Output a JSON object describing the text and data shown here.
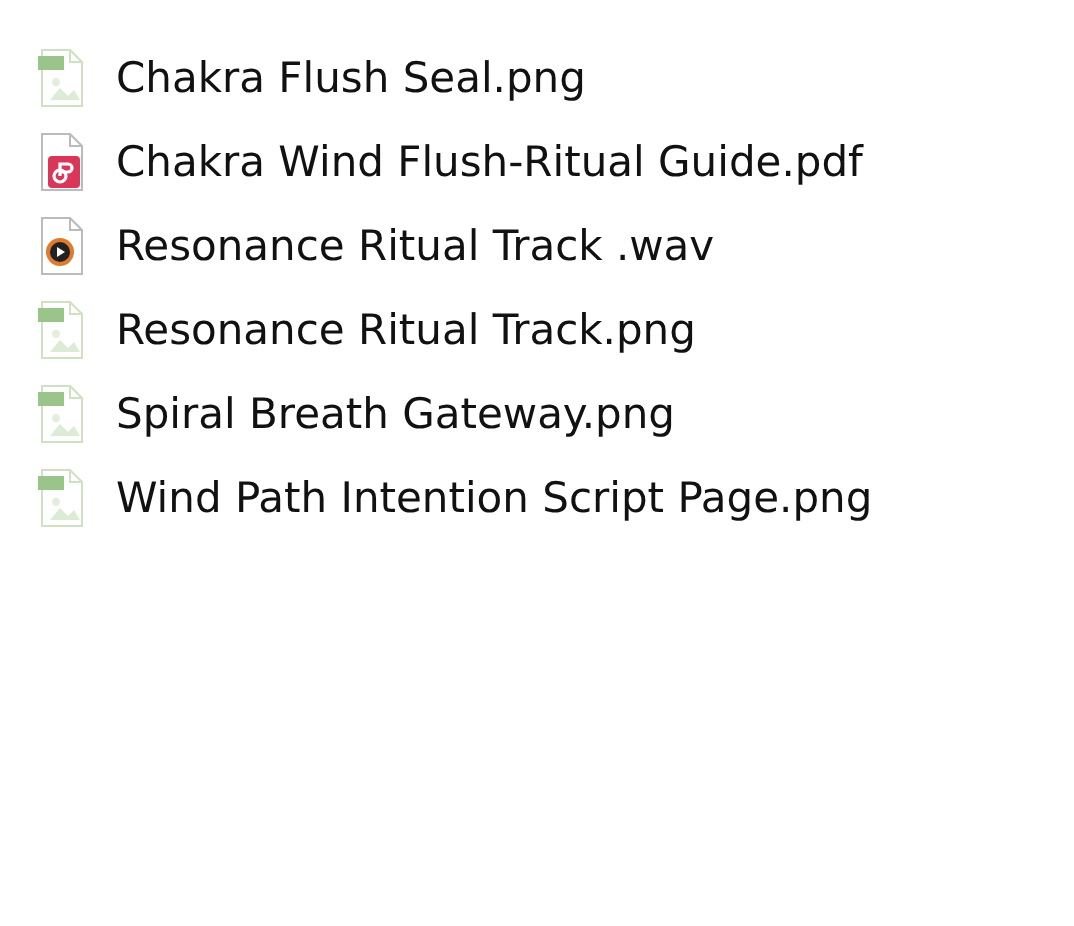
{
  "files": [
    {
      "name": "Chakra Flush Seal.png",
      "kind": "image"
    },
    {
      "name": "Chakra Wind Flush-Ritual Guide.pdf",
      "kind": "pdf"
    },
    {
      "name": "Resonance Ritual Track .wav",
      "kind": "audio"
    },
    {
      "name": "Resonance Ritual Track.png",
      "kind": "image"
    },
    {
      "name": "Spiral Breath Gateway.png",
      "kind": "image"
    },
    {
      "name": "Wind Path Intention Script Page.png",
      "kind": "image"
    }
  ]
}
